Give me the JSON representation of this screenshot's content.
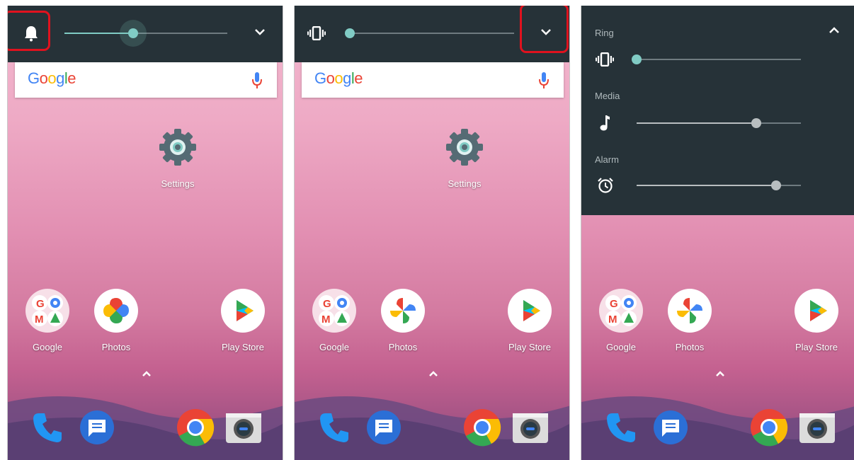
{
  "colors": {
    "panel": "#263238",
    "accent": "#80cbc4",
    "highlight": "#e0121e",
    "wallpaper_top": "#f3b8cf",
    "wallpaper_bottom": "#7a4c86"
  },
  "screens": [
    {
      "volume_panel": {
        "mode_icon": "bell-icon",
        "level": 0.42,
        "expand_icon": "chevron-down-icon",
        "highlighted": "mode-icon"
      },
      "search": {
        "logo": [
          "G",
          "o",
          "o",
          "g",
          "l",
          "e"
        ],
        "mic_icon": "mic-icon"
      },
      "settings_label": "Settings",
      "apps": [
        "Google",
        "Photos",
        "Play Store"
      ],
      "dock": [
        "phone-icon",
        "messages-icon",
        "chrome-icon",
        "camera-icon"
      ]
    },
    {
      "volume_panel": {
        "mode_icon": "vibrate-icon",
        "level": 0.0,
        "expand_icon": "chevron-down-icon",
        "highlighted": "expand-icon"
      },
      "search": {
        "logo": [
          "G",
          "o",
          "o",
          "g",
          "l",
          "e"
        ],
        "mic_icon": "mic-icon"
      },
      "settings_label": "Settings",
      "apps": [
        "Google",
        "Photos",
        "Play Store"
      ],
      "dock": [
        "phone-icon",
        "messages-icon",
        "chrome-icon",
        "camera-icon"
      ]
    },
    {
      "volume_panel": {
        "collapse_icon": "chevron-up-icon",
        "streams": [
          {
            "label": "Ring",
            "icon": "vibrate-icon",
            "level": 0.0
          },
          {
            "label": "Media",
            "icon": "music-note-icon",
            "level": 0.72
          },
          {
            "label": "Alarm",
            "icon": "alarm-icon",
            "level": 0.85
          }
        ]
      },
      "apps": [
        "Google",
        "Photos",
        "Play Store"
      ],
      "dock": [
        "phone-icon",
        "messages-icon",
        "chrome-icon",
        "camera-icon"
      ]
    }
  ]
}
